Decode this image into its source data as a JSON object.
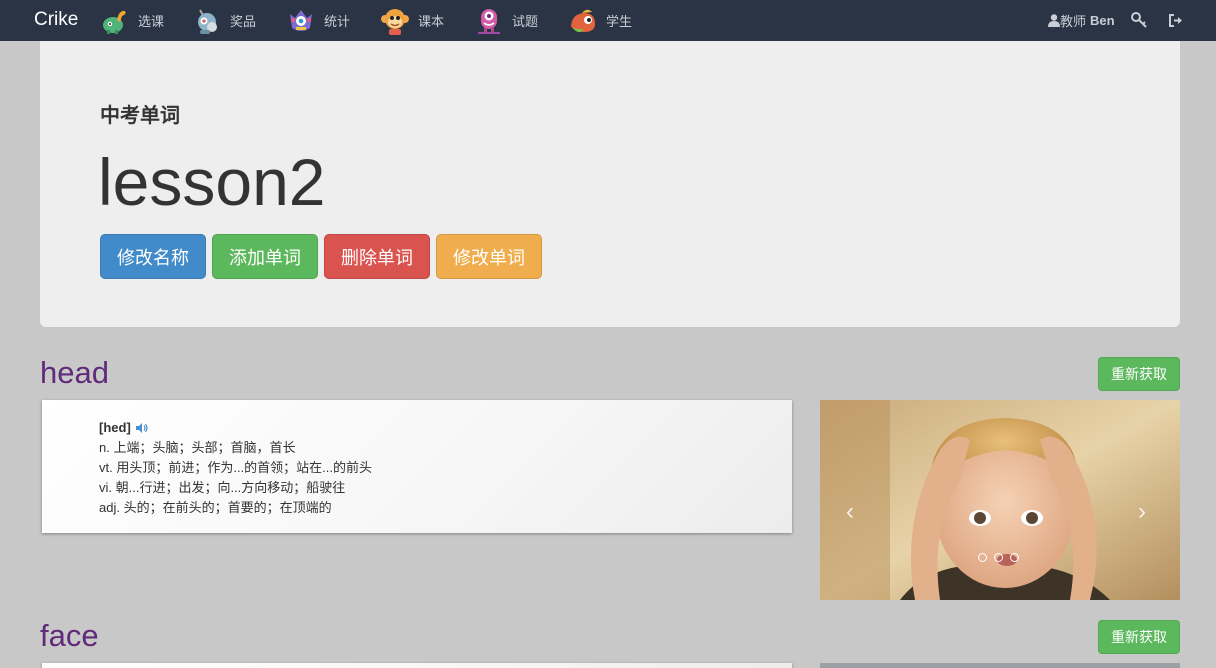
{
  "navbar": {
    "brand": "Crike",
    "items": [
      {
        "label": "选课",
        "icon": "dinosaur-icon"
      },
      {
        "label": "奖品",
        "icon": "robot-icon"
      },
      {
        "label": "统计",
        "icon": "monster-icon"
      },
      {
        "label": "课本",
        "icon": "monkey-icon"
      },
      {
        "label": "试题",
        "icon": "pink-monster-icon"
      },
      {
        "label": "学生",
        "icon": "chameleon-icon"
      }
    ],
    "user_role": "教师",
    "user_name": "Ben"
  },
  "header": {
    "subtitle": "中考单词",
    "lesson_title": "lesson2",
    "buttons": {
      "rename": "修改名称",
      "add_word": "添加单词",
      "delete_word": "删除单词",
      "edit_word": "修改单词"
    }
  },
  "words": [
    {
      "word": "head",
      "refresh_label": "重新获取",
      "phonetic": "[hed]",
      "definitions": [
        "n. 上端；头脑；头部；首脑，首长",
        "vt. 用头顶；前进；作为...的首领；站在...的前头",
        "vi. 朝...行进；出发；向...方向移动；船驶往",
        "adj. 头的；在前头的；首要的；在顶端的"
      ]
    },
    {
      "word": "face",
      "refresh_label": "重新获取"
    }
  ],
  "colors": {
    "navbar": "#2a3444",
    "primary": "#428bca",
    "success": "#5cb85c",
    "danger": "#d9534f",
    "warning": "#f0ad4e",
    "word_title": "#5f2a7a"
  }
}
